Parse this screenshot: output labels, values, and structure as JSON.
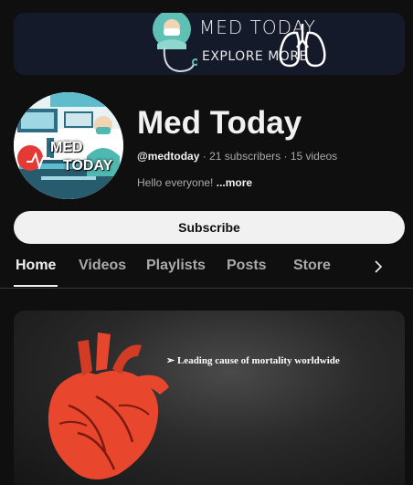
{
  "banner": {
    "title": "MED TODAY",
    "subtitle": "EXPLORE MORE"
  },
  "avatar": {
    "line1": "MED",
    "line2": "TODAY"
  },
  "channel": {
    "name": "Med Today",
    "handle": "@medtoday",
    "subscribers": "21 subscribers",
    "videos": "15 videos",
    "separator": "·",
    "description": "Hello everyone!",
    "more": "...more"
  },
  "subscribe_label": "Subscribe",
  "tabs": [
    {
      "label": "Home"
    },
    {
      "label": "Videos"
    },
    {
      "label": "Playlists"
    },
    {
      "label": "Posts"
    },
    {
      "label": "Store"
    }
  ],
  "video": {
    "caption": "Leading cause of mortality worldwide"
  },
  "colors": {
    "background": "#0f0f0f",
    "banner_bg": "#141a2a",
    "subscribe_bg": "#f1f1f1",
    "heart_red": "#e8472e",
    "avatar_red": "#e53935",
    "teal": "#4fb8b0"
  }
}
